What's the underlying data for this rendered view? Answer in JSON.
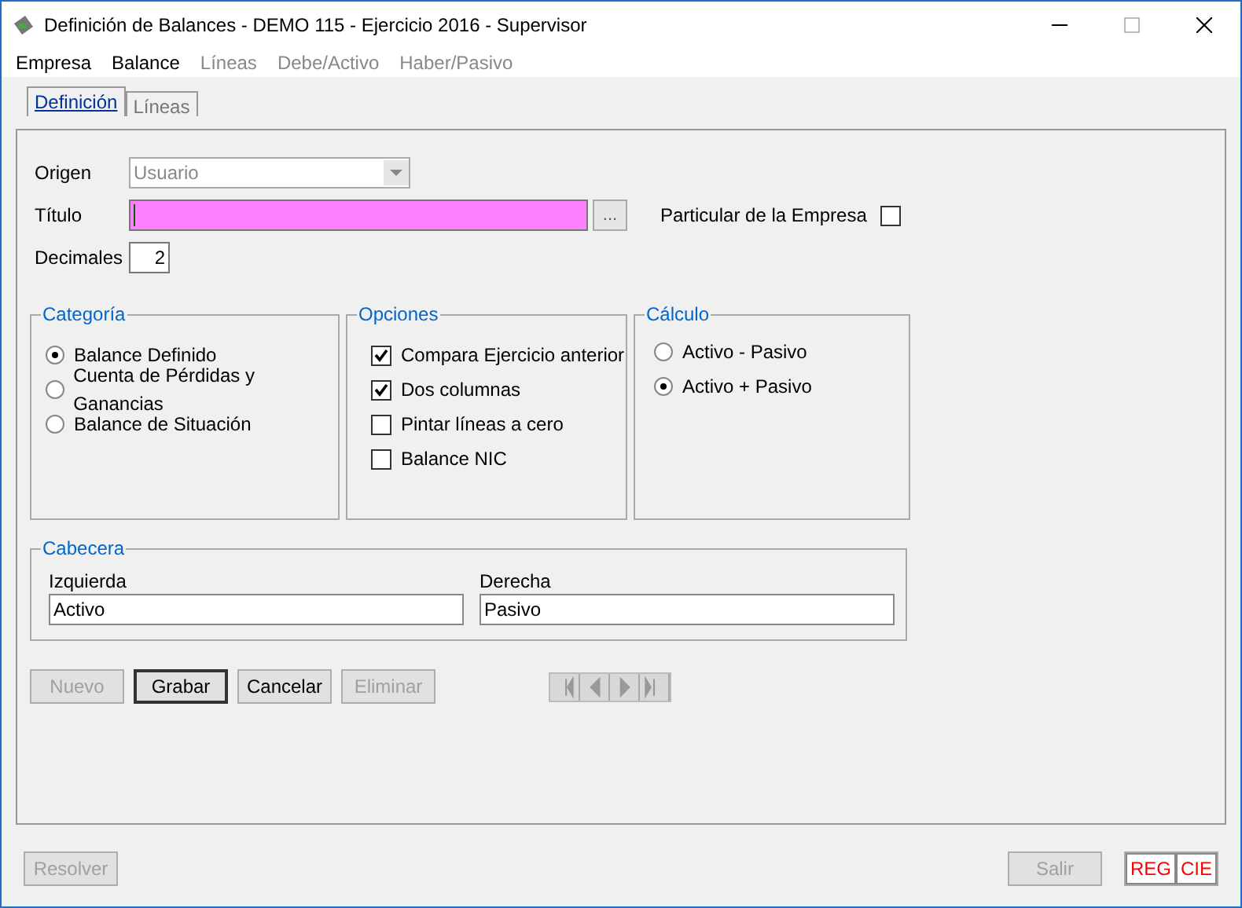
{
  "window": {
    "title": "Definición de Balances - DEMO 115 - Ejercicio 2016 - Supervisor"
  },
  "menu": [
    {
      "label": "Empresa",
      "disabled": false
    },
    {
      "label": "Balance",
      "disabled": false
    },
    {
      "label": "Líneas",
      "disabled": true
    },
    {
      "label": "Debe/Activo",
      "disabled": true
    },
    {
      "label": "Haber/Pasivo",
      "disabled": true
    }
  ],
  "tabs": [
    {
      "label": "Definición",
      "selected": true
    },
    {
      "label": "Líneas",
      "selected": false
    }
  ],
  "form": {
    "origen": {
      "label": "Origen",
      "value": "Usuario"
    },
    "titulo": {
      "label": "Título",
      "browse": "..."
    },
    "particular": {
      "label": "Particular de la Empresa",
      "checked": false
    },
    "decimales": {
      "label": "Decimales",
      "value": "2"
    }
  },
  "categoria": {
    "title": "Categoría",
    "options": [
      {
        "label": "Balance Definido",
        "selected": true
      },
      {
        "label": "Cuenta de Pérdidas y Ganancias",
        "selected": false
      },
      {
        "label": "Balance de Situación",
        "selected": false
      }
    ]
  },
  "opciones": {
    "title": "Opciones",
    "options": [
      {
        "label": "Compara Ejercicio anterior",
        "checked": true
      },
      {
        "label": "Dos columnas",
        "checked": true
      },
      {
        "label": "Pintar líneas a cero",
        "checked": false
      },
      {
        "label": "Balance NIC",
        "checked": false
      }
    ]
  },
  "calculo": {
    "title": "Cálculo",
    "options": [
      {
        "label": "Activo - Pasivo",
        "selected": false
      },
      {
        "label": "Activo + Pasivo",
        "selected": true
      }
    ]
  },
  "cabecera": {
    "title": "Cabecera",
    "fields": [
      {
        "label": "Izquierda",
        "value": "Activo"
      },
      {
        "label": "Derecha",
        "value": "Pasivo"
      }
    ]
  },
  "buttons": [
    {
      "label": "Nuevo",
      "disabled": true
    },
    {
      "label": "Grabar",
      "disabled": false
    },
    {
      "label": "Cancelar",
      "disabled": false
    },
    {
      "label": "Eliminar",
      "disabled": true
    }
  ],
  "footer": {
    "resolver": {
      "label": "Resolver",
      "disabled": true
    },
    "salir": {
      "label": "Salir",
      "disabled": true
    },
    "indicators": [
      "REG",
      "CIE"
    ]
  }
}
